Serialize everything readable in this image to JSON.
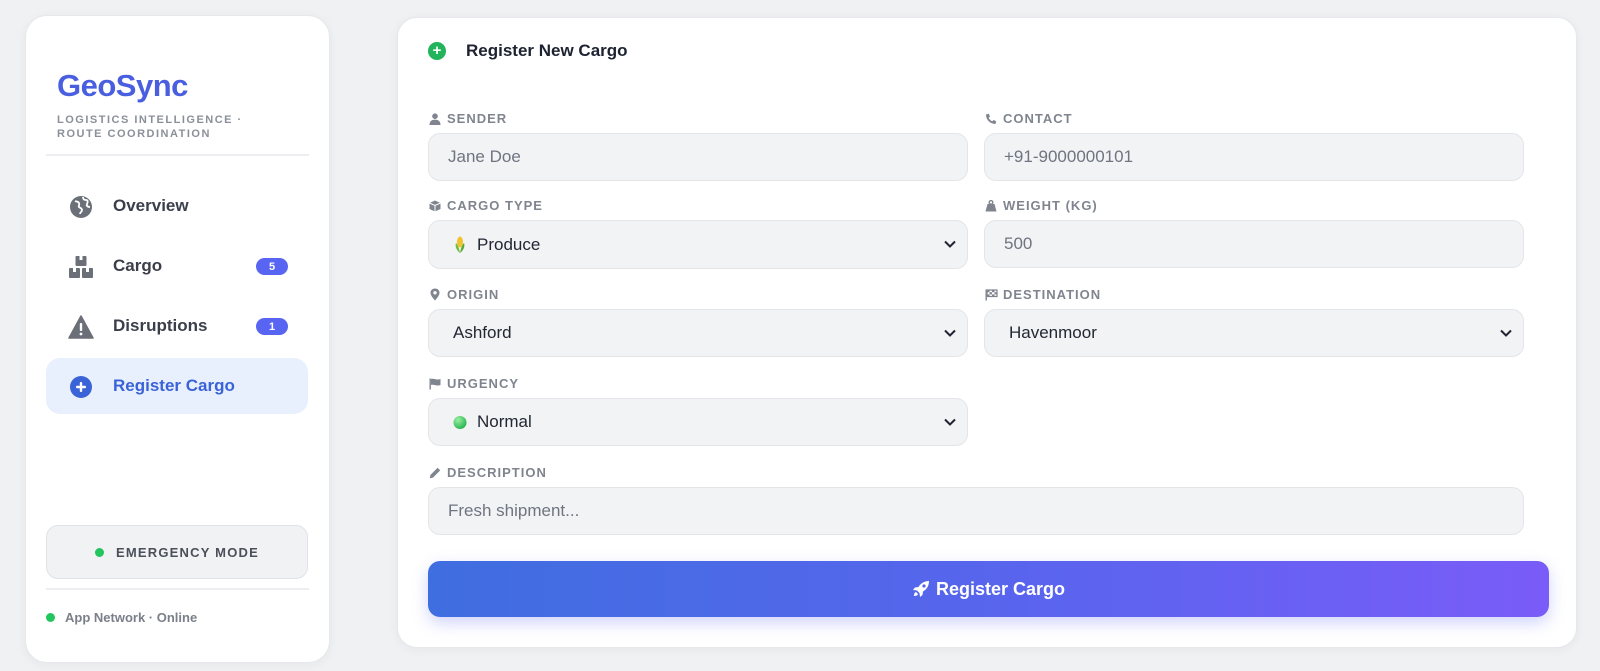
{
  "brand": {
    "name": "GeoSync",
    "tagline": "LOGISTICS INTELLIGENCE · ROUTE COORDINATION"
  },
  "nav": {
    "items": [
      {
        "label": "Overview",
        "icon": "globe-icon"
      },
      {
        "label": "Cargo",
        "icon": "boxes-icon",
        "badge": "5"
      },
      {
        "label": "Disruptions",
        "icon": "warning-icon",
        "badge": "1"
      },
      {
        "label": "Register Cargo",
        "icon": "plus-circle-icon",
        "active": true
      }
    ]
  },
  "sidebar": {
    "emergency_label": "EMERGENCY MODE",
    "network_status": "App Network · Online"
  },
  "form": {
    "title": "Register New Cargo",
    "sender": {
      "label": "SENDER",
      "placeholder": "Jane Doe",
      "icon": "user-icon"
    },
    "contact": {
      "label": "CONTACT",
      "placeholder": "+91-9000000101",
      "icon": "phone-icon"
    },
    "cargo_type": {
      "label": "CARGO TYPE",
      "value": "Produce",
      "icon": "cube-icon",
      "value_icon": "corn-icon"
    },
    "weight": {
      "label": "WEIGHT (KG)",
      "placeholder": "500",
      "icon": "weight-icon"
    },
    "origin": {
      "label": "ORIGIN",
      "value": "Ashford",
      "icon": "map-pin-icon"
    },
    "destination": {
      "label": "DESTINATION",
      "value": "Havenmoor",
      "icon": "flag-checkered-icon"
    },
    "urgency": {
      "label": "URGENCY",
      "value": "Normal",
      "icon": "flag-icon",
      "value_icon": "green-circle-icon"
    },
    "description": {
      "label": "DESCRIPTION",
      "placeholder": "Fresh shipment...",
      "icon": "pencil-icon"
    },
    "submit_label": "Register Cargo"
  },
  "colors": {
    "accent": "#4a5fe0",
    "online": "#22c55e",
    "badge": "#5865f2",
    "active_bg": "#e8f0fd"
  }
}
